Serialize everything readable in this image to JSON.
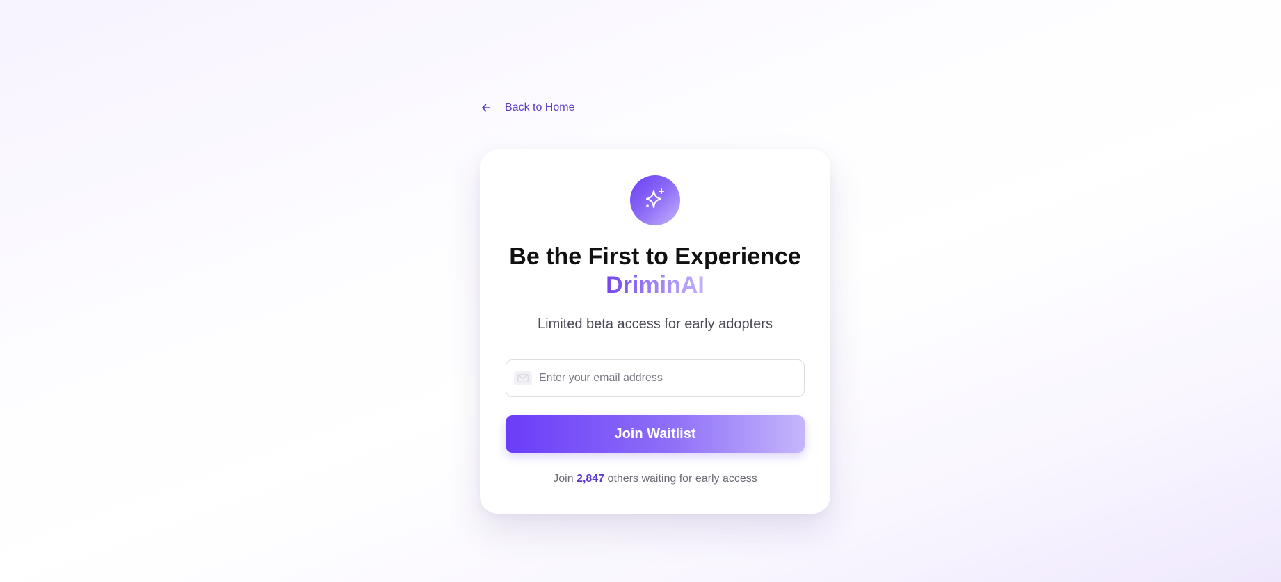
{
  "nav": {
    "back_label": "Back to Home",
    "back_icon": "arrow-left-icon"
  },
  "card": {
    "logo_icon": "sparkles-icon",
    "headline": "Be the First to Experience",
    "brand": "DriminAI",
    "subtitle": "Limited beta access for early adopters",
    "email": {
      "placeholder": "Enter your email address",
      "value": "",
      "icon": "mail-icon"
    },
    "submit_label": "Join Waitlist",
    "waiting": {
      "prefix": "Join",
      "count": "2,847",
      "suffix": "others waiting for early access"
    }
  },
  "colors": {
    "accent": "#6a3cf8",
    "accent_light": "#c5b6fb",
    "link": "#5b3cc4",
    "headline": "#111111"
  }
}
